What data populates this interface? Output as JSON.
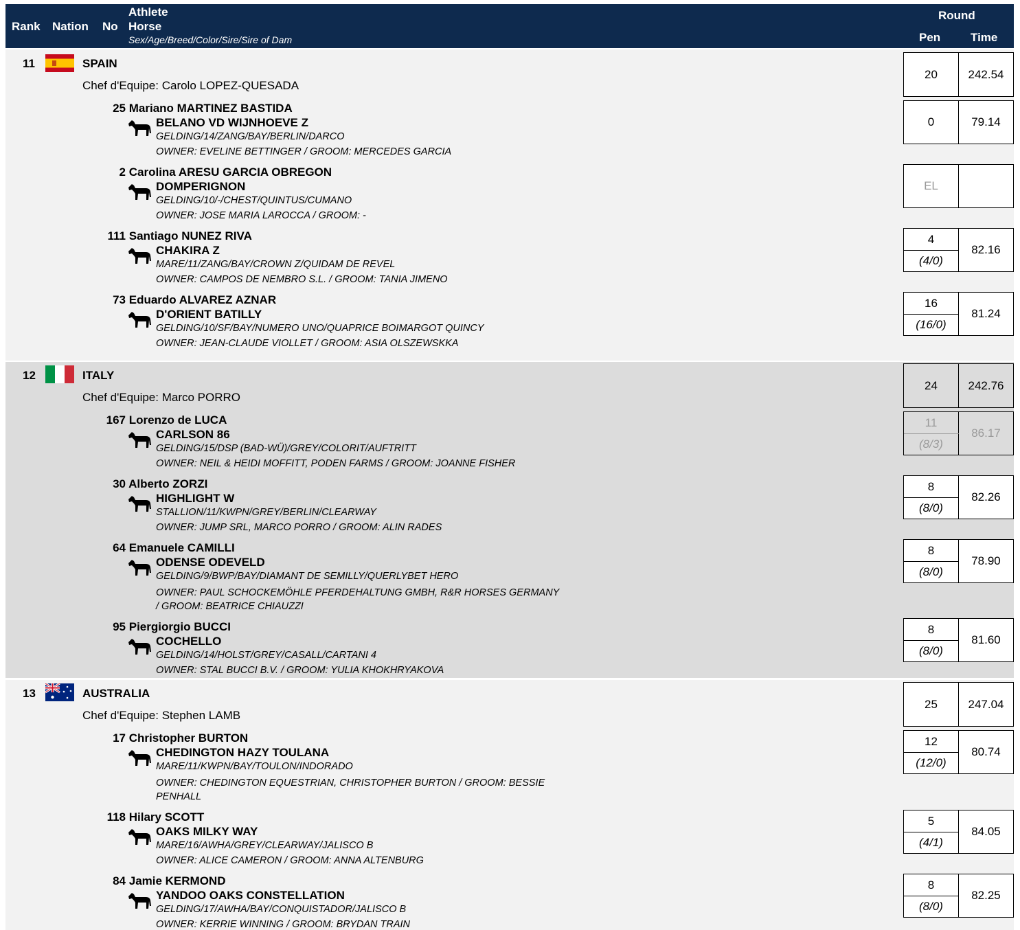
{
  "header": {
    "rank": "Rank",
    "nation": "Nation",
    "no": "No",
    "athlete": "Athlete",
    "horse": "Horse",
    "horse_sub": "Sex/Age/Breed/Color/Sire/Sire of Dam",
    "round": "Round",
    "pen": "Pen",
    "time": "Time"
  },
  "colors": {
    "header_bg": "#0e2a4e",
    "band_light": "#f2f2f2",
    "band_dark": "#dcdcdc",
    "faded_text": "#9a9a9a"
  },
  "teams": [
    {
      "rank": "11",
      "flag": "spain-flag-icon",
      "nation": "SPAIN",
      "chef": "Chef d'Equipe: Carolo LOPEZ-QUESADA",
      "pen": "20",
      "time": "242.54",
      "athletes": [
        {
          "no": "25",
          "name": "Mariano MARTINEZ BASTIDA",
          "horse": "BELANO VD WIJNHOEVE Z",
          "details": "GELDING/14/ZANG/BAY/BERLIN/DARCO",
          "owner": "OWNER: EVELINE BETTINGER / GROOM: MERCEDES GARCIA",
          "pen": "0",
          "sub": "",
          "time": "79.14"
        },
        {
          "no": "2",
          "name": "Carolina ARESU GARCIA OBREGON",
          "horse": "DOMPERIGNON",
          "details": "GELDING/10/-/CHEST/QUINTUS/CUMANO",
          "owner": "OWNER: JOSE MARIA LAROCCA / GROOM: -",
          "pen": "EL",
          "sub": "",
          "time": ""
        },
        {
          "no": "111",
          "name": "Santiago NUNEZ RIVA",
          "horse": "CHAKIRA Z",
          "details": "MARE/11/ZANG/BAY/CROWN Z/QUIDAM DE REVEL",
          "owner": "OWNER: CAMPOS DE NEMBRO S.L. / GROOM: TANIA JIMENO",
          "pen": "4",
          "sub": "(4/0)",
          "time": "82.16"
        },
        {
          "no": "73",
          "name": "Eduardo ALVAREZ AZNAR",
          "horse": "D'ORIENT BATILLY",
          "details": "GELDING/10/SF/BAY/NUMERO UNO/QUAPRICE BOIMARGOT QUINCY",
          "owner": "OWNER: JEAN-CLAUDE VIOLLET / GROOM: ASIA OLSZEWSKKA",
          "pen": "16",
          "sub": "(16/0)",
          "time": "81.24"
        }
      ]
    },
    {
      "rank": "12",
      "flag": "italy-flag-icon",
      "nation": "ITALY",
      "chef": "Chef d'Equipe: Marco PORRO",
      "pen": "24",
      "time": "242.76",
      "athletes": [
        {
          "no": "167",
          "name": "Lorenzo de LUCA",
          "horse": "CARLSON 86",
          "details": "GELDING/15/DSP (BAD-WÜ)/GREY/COLORIT/AUFTRITT",
          "owner": "OWNER: NEIL & HEIDI MOFFITT, PODEN FARMS / GROOM: JOANNE FISHER",
          "pen": "11",
          "sub": "(8/3)",
          "time": "86.17"
        },
        {
          "no": "30",
          "name": "Alberto ZORZI",
          "horse": "HIGHLIGHT W",
          "details": "STALLION/11/KWPN/GREY/BERLIN/CLEARWAY",
          "owner": "OWNER: JUMP SRL, MARCO PORRO / GROOM: ALIN RADES",
          "pen": "8",
          "sub": "(8/0)",
          "time": "82.26"
        },
        {
          "no": "64",
          "name": "Emanuele CAMILLI",
          "horse": "ODENSE ODEVELD",
          "details": "GELDING/9/BWP/BAY/DIAMANT DE SEMILLY/QUERLYBET HERO",
          "owner": "OWNER: PAUL SCHOCKEMÖHLE PFERDEHALTUNG GMBH, R&R HORSES GERMANY / GROOM: BEATRICE CHIAUZZI",
          "pen": "8",
          "sub": "(8/0)",
          "time": "78.90"
        },
        {
          "no": "95",
          "name": "Piergiorgio BUCCI",
          "horse": "COCHELLO",
          "details": "GELDING/14/HOLST/GREY/CASALL/CARTANI 4",
          "owner": "OWNER: STAL BUCCI B.V. / GROOM: YULIA KHOKHRYAKOVA",
          "pen": "8",
          "sub": "(8/0)",
          "time": "81.60"
        }
      ]
    },
    {
      "rank": "13",
      "flag": "australia-flag-icon",
      "nation": "AUSTRALIA",
      "chef": "Chef d'Equipe: Stephen LAMB",
      "pen": "25",
      "time": "247.04",
      "athletes": [
        {
          "no": "17",
          "name": "Christopher BURTON",
          "horse": "CHEDINGTON HAZY TOULANA",
          "details": "MARE/11/KWPN/BAY/TOULON/INDORADO",
          "owner": "OWNER: CHEDINGTON EQUESTRIAN, CHRISTOPHER BURTON / GROOM: BESSIE PENHALL",
          "pen": "12",
          "sub": "(12/0)",
          "time": "80.74"
        },
        {
          "no": "118",
          "name": "Hilary SCOTT",
          "horse": "OAKS MILKY WAY",
          "details": "MARE/16/AWHA/GREY/CLEARWAY/JALISCO B",
          "owner": "OWNER: ALICE CAMERON / GROOM: ANNA ALTENBURG",
          "pen": "5",
          "sub": "(4/1)",
          "time": "84.05"
        },
        {
          "no": "84",
          "name": "Jamie KERMOND",
          "horse": "YANDOO OAKS CONSTELLATION",
          "details": "GELDING/17/AWHA/BAY/CONQUISTADOR/JALISCO B",
          "owner": "OWNER: KERRIE WINNING / GROOM: BRYDAN TRAIN",
          "pen": "8",
          "sub": "(8/0)",
          "time": "82.25"
        }
      ]
    }
  ]
}
